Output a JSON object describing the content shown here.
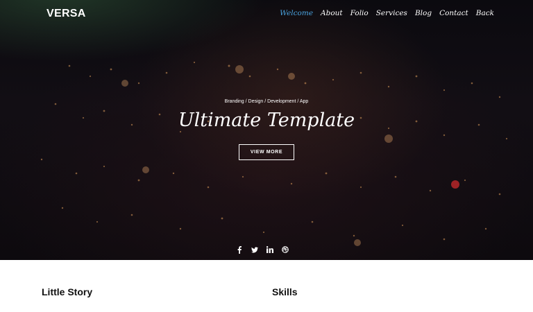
{
  "brand": {
    "name": "VERSA"
  },
  "nav": {
    "items": [
      {
        "label": "Welcome",
        "active": true
      },
      {
        "label": "About"
      },
      {
        "label": "Folio"
      },
      {
        "label": "Services"
      },
      {
        "label": "Blog"
      },
      {
        "label": "Contact"
      },
      {
        "label": "Back"
      }
    ],
    "active_color": "#4aa3df"
  },
  "hero": {
    "subtitle": "Branding / Design / Development / App",
    "title": "Ultimate Template",
    "cta_label": "VIEW MORE"
  },
  "social": {
    "icons": [
      "facebook-icon",
      "twitter-icon",
      "linkedin-icon",
      "dribbble-icon"
    ]
  },
  "sections": {
    "story_title": "Little Story",
    "skills_title": "Skills"
  }
}
